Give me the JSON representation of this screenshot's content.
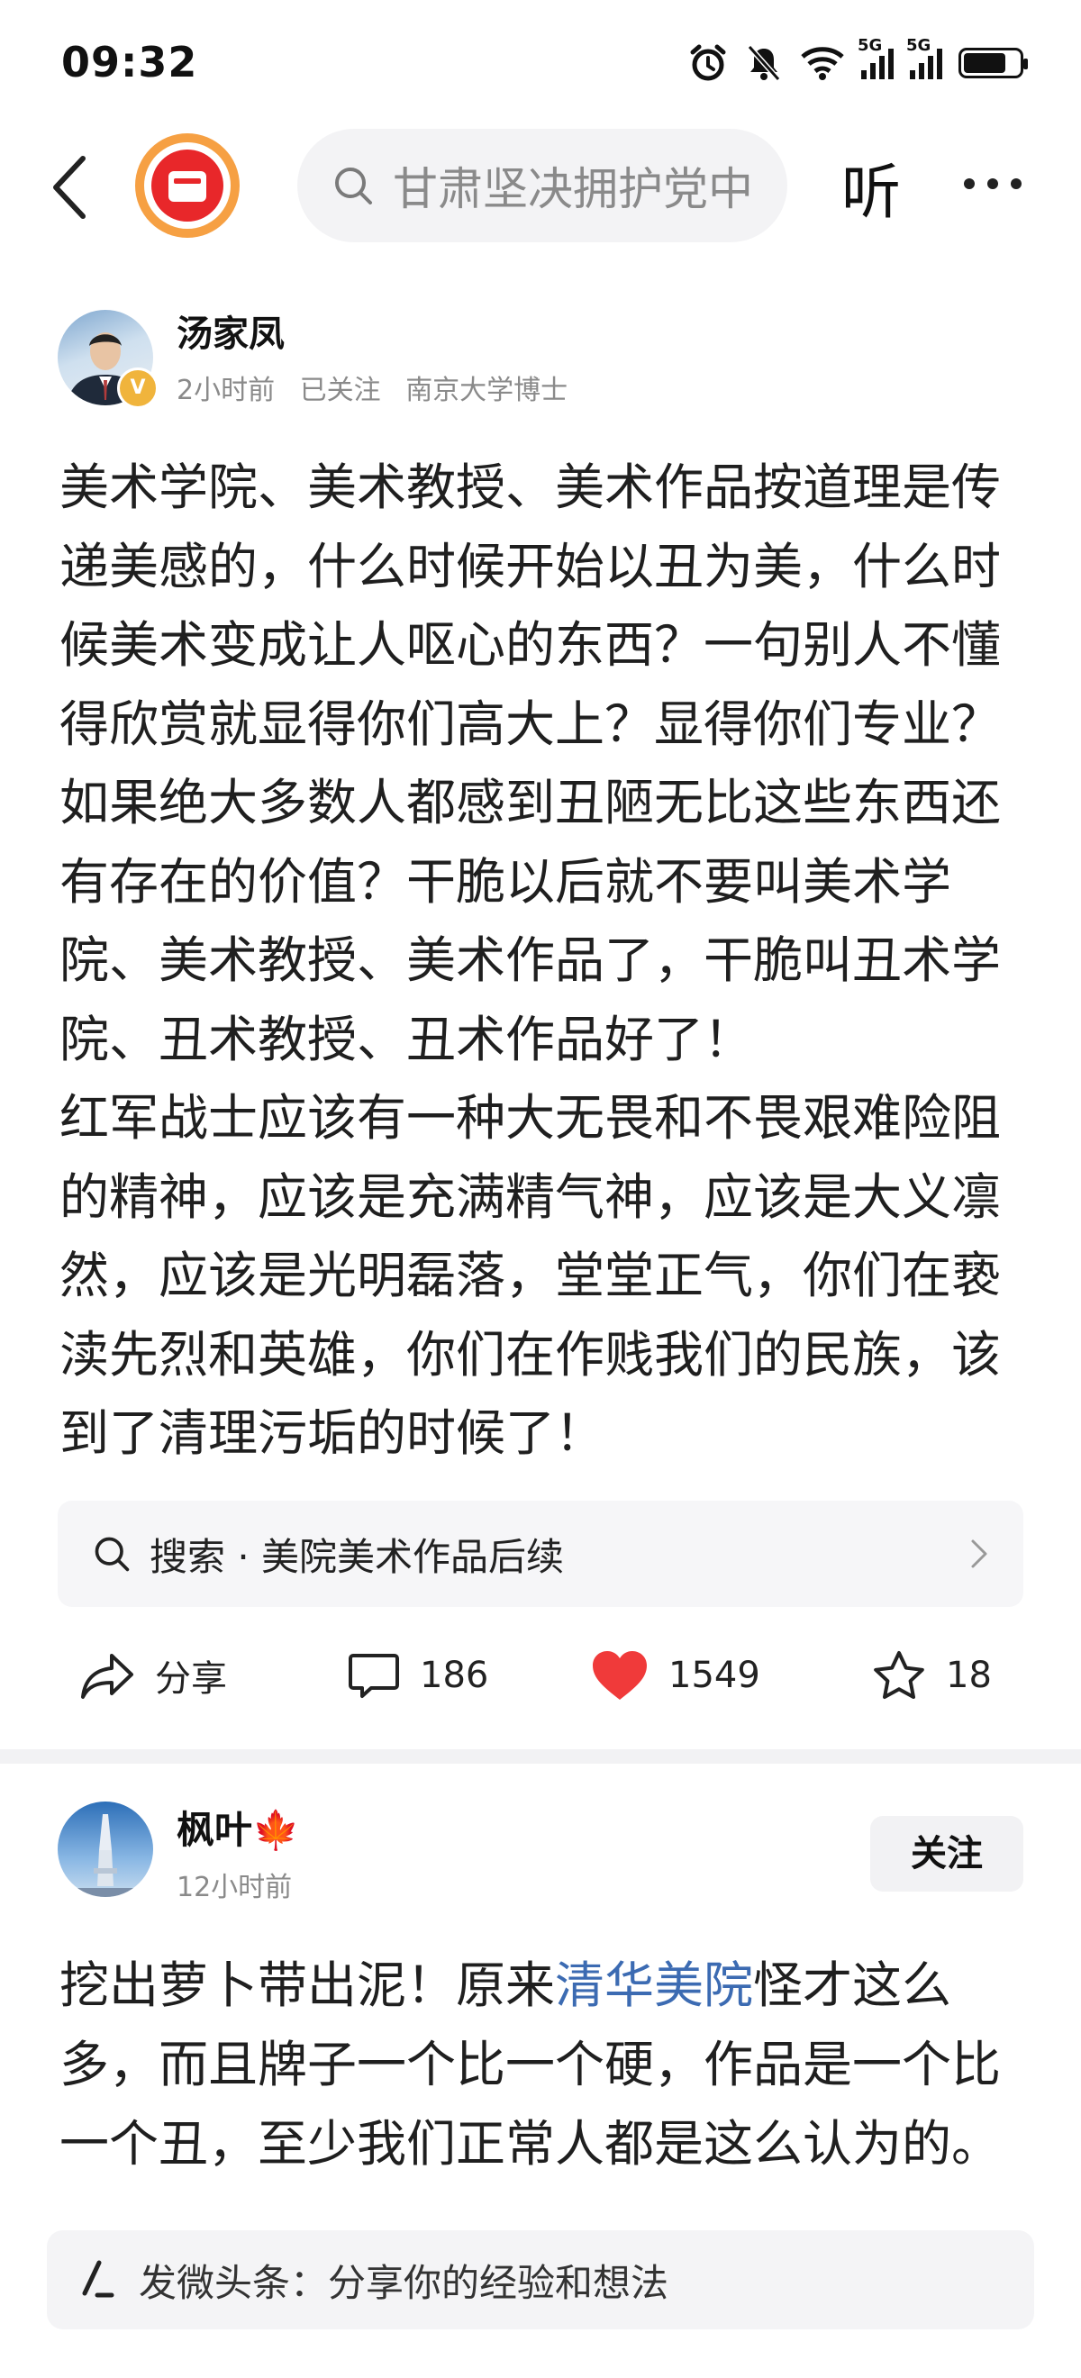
{
  "status_bar": {
    "time": "09:32",
    "network_labels": [
      "5G",
      "5G"
    ],
    "icons": [
      "alarm-icon",
      "mute-icon",
      "wifi-icon",
      "signal-icon",
      "battery-icon"
    ]
  },
  "nav": {
    "search_text": "甘肃坚决拥护党中",
    "listen_label": "听",
    "app_logo": "toutiao-logo"
  },
  "author": {
    "name": "汤家凤",
    "time": "2小时前",
    "follow_status": "已关注",
    "title": "南京大学博士",
    "badge": "V"
  },
  "post": {
    "paragraphs": [
      "美术学院、美术教授、美术作品按道理是传递美感的，什么时候开始以丑为美，什么时候美术变成让人呕心的东西？一句别人不懂得欣赏就显得你们高大上？显得你们专业？如果绝大多数人都感到丑陋无比这些东西还有存在的价值？干脆以后就不要叫美术学院、美术教授、美术作品了，干脆叫丑术学院、丑术教授、丑术作品好了！",
      "红军战士应该有一种大无畏和不畏艰难险阻的精神，应该是充满精气神，应该是大义凛然，应该是光明磊落，堂堂正气，你们在亵渎先烈和英雄，你们在作贱我们的民族，该到了清理污垢的时候了！"
    ]
  },
  "search_suggestion": {
    "text": "搜索 · 美院美术作品后续"
  },
  "actions": {
    "share_label": "分享",
    "comments": "186",
    "likes": "1549",
    "favorites": "18",
    "like_color": "#f03a3a"
  },
  "comment": {
    "name": "枫叶🍁",
    "time": "12小时前",
    "follow_label": "关注",
    "text_before": "挖出萝卜带出泥！原来",
    "highlight": "清华美院",
    "text_after": "怪才这么多，而且牌子一个比一个硬，作品是一个比一个丑，至少我们正常人都是这么认为的。",
    "highlight_color": "#3c6bb2"
  },
  "composer": {
    "placeholder": "发微头条：分享你的经验和想法"
  }
}
